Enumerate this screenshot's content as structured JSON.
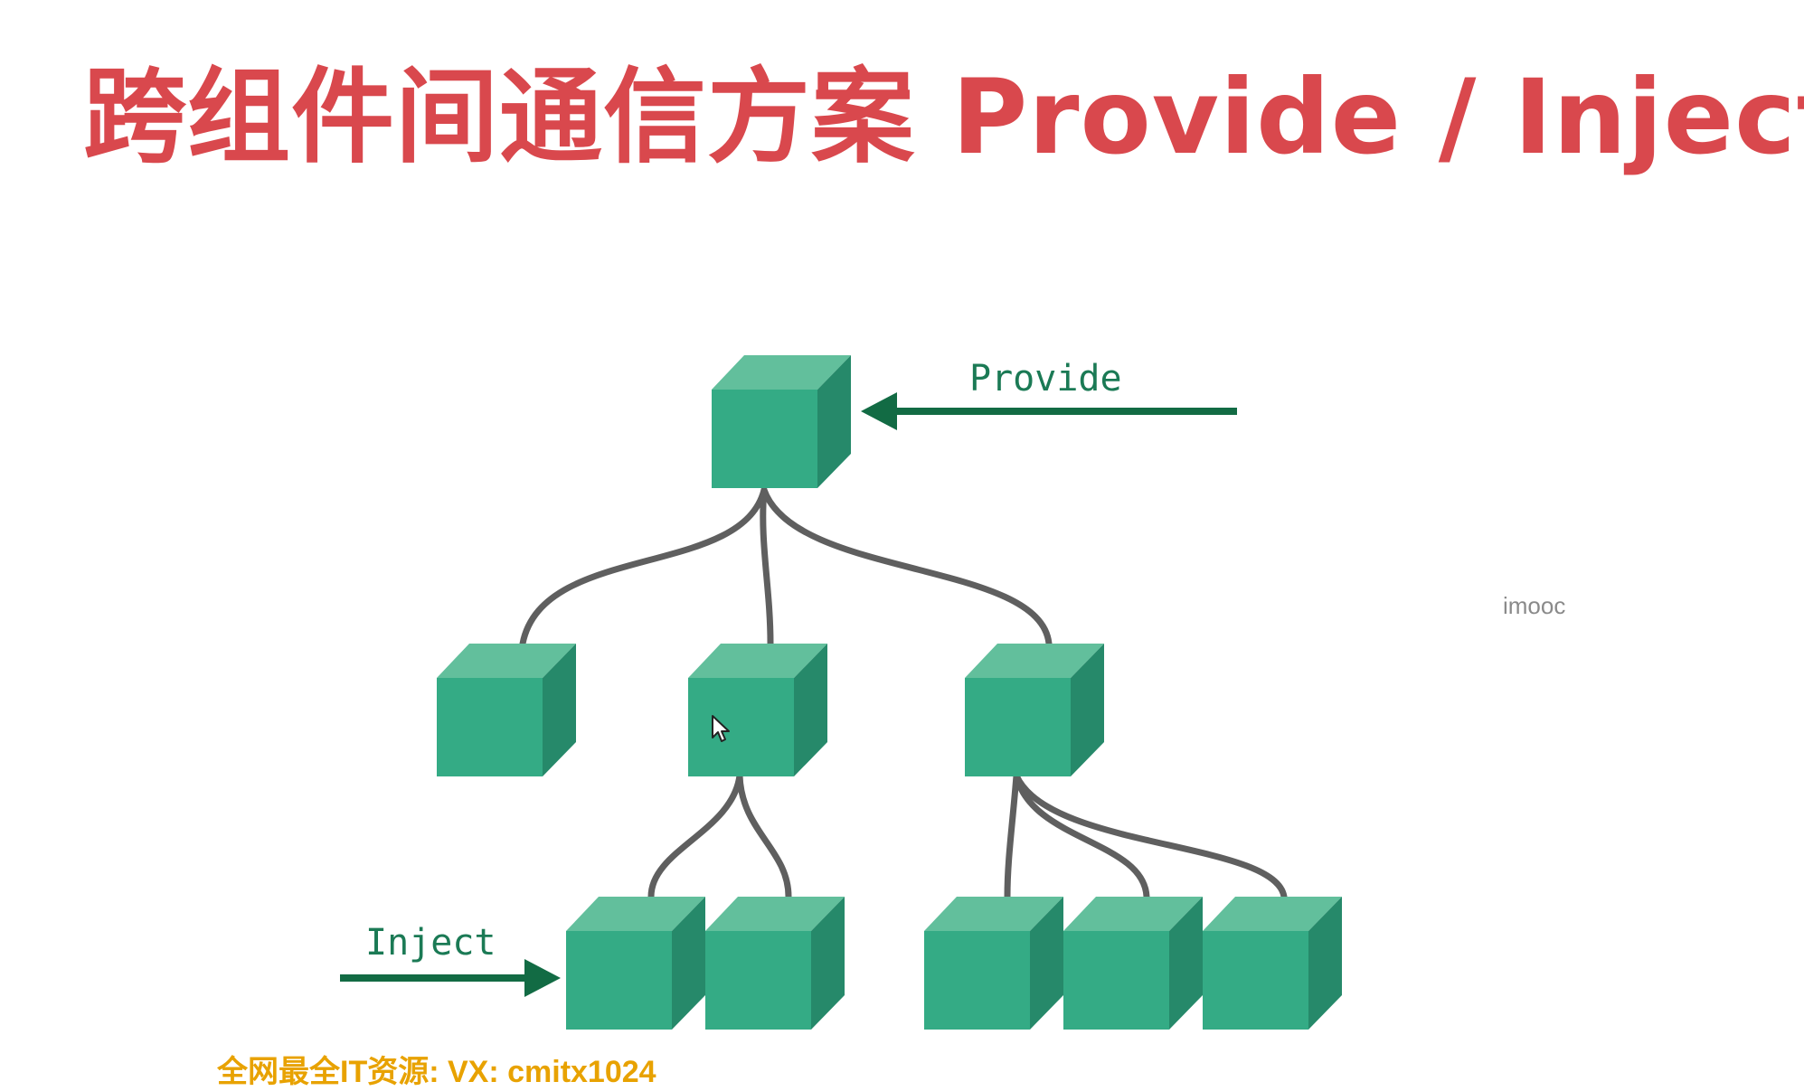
{
  "slide": {
    "title": "跨组件间通信方案 Provide / Inject",
    "watermark": "imooc",
    "footer": "全网最全IT资源: VX: cmitx1024"
  },
  "diagram": {
    "provide_label": "Provide",
    "inject_label": "Inject",
    "colors": {
      "cube_front": "#34ab85",
      "cube_top": "#62bf9c",
      "cube_side": "#26896a",
      "edge": "#5f5f5f",
      "arrow": "#126b44"
    },
    "nodes": [
      "root",
      "child-left",
      "child-middle",
      "child-right",
      "grandchild-1",
      "grandchild-2",
      "grandchild-3",
      "grandchild-4",
      "grandchild-5"
    ]
  }
}
